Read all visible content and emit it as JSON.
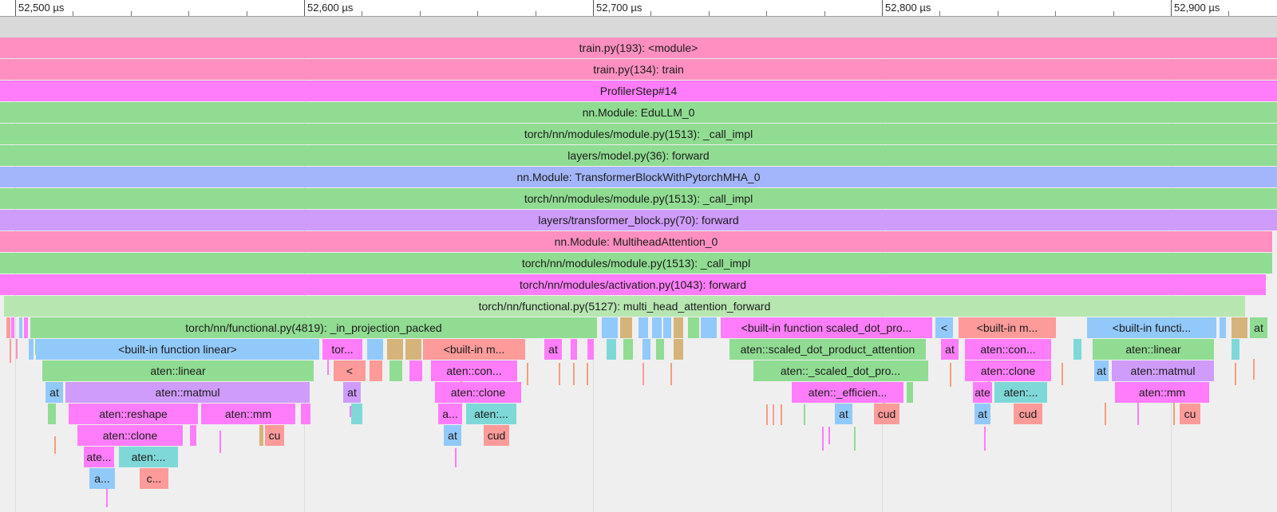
{
  "colors": {
    "pink": "#ff8fc0",
    "magenta": "#ff7dfa",
    "green": "#90dc92",
    "blue": "#a3b6fb",
    "purple": "#cf9cfc",
    "light_green": "#b7e6b1",
    "sky": "#92c9fb",
    "salmon": "#fd9a9a",
    "teal": "#7fd8d8",
    "tan": "#d4b47a",
    "orange": "#f2a07a"
  },
  "ruler": {
    "labels": [
      "52,500 µs",
      "52,600 µs",
      "52,700 µs",
      "52,800 µs",
      "52,900 µs"
    ]
  },
  "frames": [
    {
      "name": "train.py(193): <module>",
      "color": "pink"
    },
    {
      "name": "train.py(134): train",
      "color": "pink"
    },
    {
      "name": "ProfilerStep#14",
      "color": "magenta"
    },
    {
      "name": "nn.Module: EduLLM_0",
      "color": "green"
    },
    {
      "name": "torch/nn/modules/module.py(1513): _call_impl",
      "color": "green"
    },
    {
      "name": "layers/model.py(36): forward",
      "color": "green"
    },
    {
      "name": "nn.Module: TransformerBlockWithPytorchMHA_0",
      "color": "blue"
    },
    {
      "name": "torch/nn/modules/module.py(1513): _call_impl",
      "color": "green"
    },
    {
      "name": "layers/transformer_block.py(70): forward",
      "color": "purple"
    },
    {
      "name": "nn.Module: MultiheadAttention_0",
      "color": "pink"
    },
    {
      "name": "torch/nn/modules/module.py(1513): _call_impl",
      "color": "green"
    },
    {
      "name": "torch/nn/modules/activation.py(1043): forward",
      "color": "magenta"
    },
    {
      "name": "torch/nn/functional.py(5127): multi_head_attention_forward",
      "color": "light_green"
    },
    {
      "name": "torch/nn/functional.py(4819): _in_projection_packed",
      "color": "green"
    },
    {
      "name": "",
      "color": "tan"
    },
    {
      "name": "",
      "color": "tan"
    },
    {
      "name": "<built-in function scaled_dot_pro...",
      "color": "magenta"
    },
    {
      "name": "<",
      "color": "sky"
    },
    {
      "name": "<built-in m...",
      "color": "salmon"
    },
    {
      "name": "<built-in functi...",
      "color": "sky"
    },
    {
      "name": "at",
      "color": "green"
    },
    {
      "name": "<built-in function linear>",
      "color": "sky"
    },
    {
      "name": "tor...",
      "color": "magenta"
    },
    {
      "name": "<built-in m...",
      "color": "salmon"
    },
    {
      "name": "at",
      "color": "magenta"
    },
    {
      "name": "aten::scaled_dot_product_attention",
      "color": "green"
    },
    {
      "name": "at",
      "color": "magenta"
    },
    {
      "name": "aten::con...",
      "color": "magenta"
    },
    {
      "name": "aten::linear",
      "color": "green"
    },
    {
      "name": "aten::linear",
      "color": "green"
    },
    {
      "name": "<",
      "color": "salmon"
    },
    {
      "name": "aten::con...",
      "color": "magenta"
    },
    {
      "name": "aten::_scaled_dot_pro...",
      "color": "green"
    },
    {
      "name": "aten::clone",
      "color": "magenta"
    },
    {
      "name": "at",
      "color": "sky"
    },
    {
      "name": "aten::matmul",
      "color": "purple"
    },
    {
      "name": "at",
      "color": "sky"
    },
    {
      "name": "aten::matmul",
      "color": "purple"
    },
    {
      "name": "at",
      "color": "purple"
    },
    {
      "name": "aten::clone",
      "color": "magenta"
    },
    {
      "name": "aten::_efficien...",
      "color": "magenta"
    },
    {
      "name": "ate",
      "color": "magenta"
    },
    {
      "name": "aten:...",
      "color": "teal"
    },
    {
      "name": "aten::mm",
      "color": "magenta"
    },
    {
      "name": "aten::reshape",
      "color": "magenta"
    },
    {
      "name": "aten::mm",
      "color": "magenta"
    },
    {
      "name": "a...",
      "color": "magenta"
    },
    {
      "name": "aten:...",
      "color": "teal"
    },
    {
      "name": "at",
      "color": "sky"
    },
    {
      "name": "cud",
      "color": "salmon"
    },
    {
      "name": "at",
      "color": "sky"
    },
    {
      "name": "cud",
      "color": "salmon"
    },
    {
      "name": "cu",
      "color": "salmon"
    },
    {
      "name": "aten::clone",
      "color": "magenta"
    },
    {
      "name": "cu",
      "color": "salmon"
    },
    {
      "name": "at",
      "color": "sky"
    },
    {
      "name": "cud",
      "color": "salmon"
    },
    {
      "name": "ate...",
      "color": "magenta"
    },
    {
      "name": "aten:...",
      "color": "teal"
    },
    {
      "name": "a...",
      "color": "sky"
    },
    {
      "name": "c...",
      "color": "salmon"
    }
  ]
}
